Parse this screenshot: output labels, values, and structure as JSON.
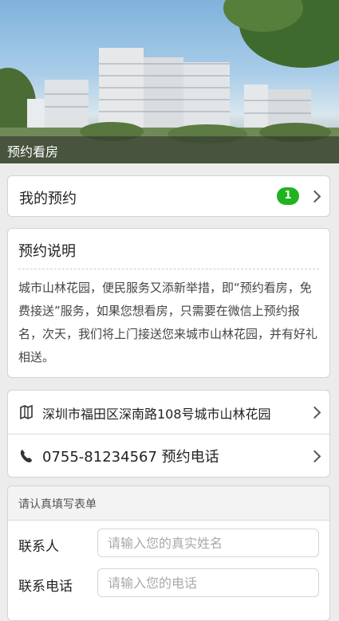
{
  "hero": {
    "caption": "预约看房"
  },
  "my_reservation": {
    "label": "我的预约",
    "count": "1"
  },
  "description": {
    "title": "预约说明",
    "body": "城市山林花园，便民服务又添新举措，即“预约看房，免费接送”服务，如果您想看房，只需要在微信上预约报名，次天，我们将上门接送您来城市山林花园，并有好礼相送。"
  },
  "contact": {
    "address": "深圳市福田区深南路108号城市山林花园",
    "phone": "0755-81234567 预约电话"
  },
  "form": {
    "header": "请认真填写表单",
    "fields": [
      {
        "label": "联系人",
        "placeholder": "请输入您的真实姓名"
      },
      {
        "label": "联系电话",
        "placeholder": "请输入您的电话"
      }
    ]
  }
}
